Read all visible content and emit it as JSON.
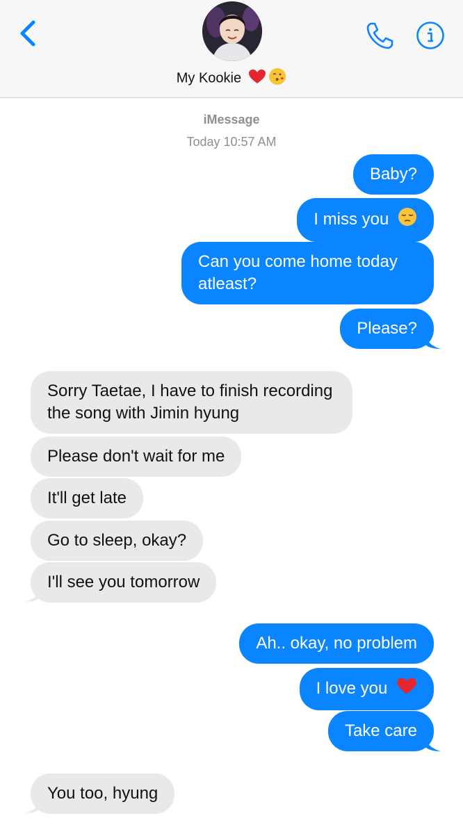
{
  "header": {
    "contact_name": "My Kookie",
    "contact_emojis": [
      "red-heart",
      "kiss-face"
    ]
  },
  "meta": {
    "service": "iMessage",
    "timestamp": "Today 10:57 AM"
  },
  "messages": [
    {
      "from": "me",
      "text": "Baby?"
    },
    {
      "from": "me",
      "text": "I miss you",
      "emoji": "pensive-face"
    },
    {
      "from": "me",
      "text": "Can you come home today atleast?"
    },
    {
      "from": "me",
      "text": "Please?"
    },
    {
      "from": "them",
      "text": "Sorry Taetae, I have to finish recording the song with Jimin hyung"
    },
    {
      "from": "them",
      "text": "Please don't wait for me"
    },
    {
      "from": "them",
      "text": "It'll get late"
    },
    {
      "from": "them",
      "text": "Go to sleep, okay?"
    },
    {
      "from": "them",
      "text": "I'll see you tomorrow"
    },
    {
      "from": "me",
      "text": "Ah.. okay, no problem"
    },
    {
      "from": "me",
      "text": "I love you",
      "emoji": "red-heart"
    },
    {
      "from": "me",
      "text": "Take care"
    },
    {
      "from": "them",
      "text": "You too, hyung"
    }
  ],
  "colors": {
    "sent_bubble": "#0a84ff",
    "received_bubble": "#e9e9eb",
    "accent": "#0a84ff",
    "header_bg": "#f7f7f7"
  }
}
